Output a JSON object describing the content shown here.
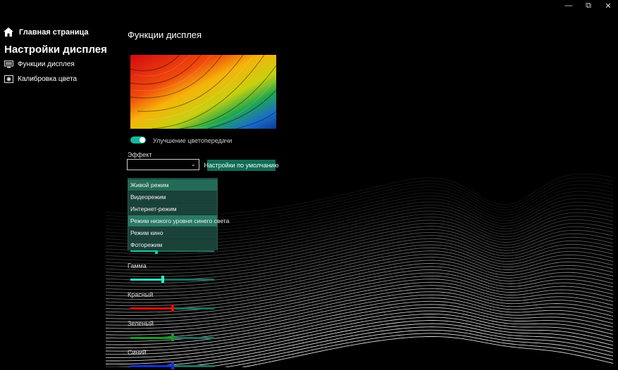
{
  "window": {
    "minimize_glyph": "—",
    "maximize_glyph": "⧉",
    "close_glyph": "✕"
  },
  "sidebar": {
    "home_label": "Главная страница",
    "section_title": "Настройки дисплея",
    "items": [
      {
        "label": "Функции дисплея",
        "icon": "monitor-icon"
      },
      {
        "label": "Калибровка цвета",
        "icon": "calibration-icon"
      }
    ]
  },
  "main": {
    "page_title": "Функции дисплея",
    "color_enhancement": {
      "label": "Улучшение цветопередачи",
      "on": true
    },
    "effect": {
      "label": "Эффект",
      "selected": "",
      "chevron": "⌄",
      "options": [
        "Живой режим",
        "Видеорежим",
        "Интернет-режим",
        "Режим низкого уровня синего света",
        "Режим кино",
        "Фоторежим"
      ],
      "active_index": 0,
      "hover_index": 3
    },
    "default_button": "Настройки по умолчанию",
    "sliders": [
      {
        "label": "",
        "value": 0.31,
        "color": "#18c9a4"
      },
      {
        "label": "Гамма",
        "value": 0.39,
        "color": "#2ef0c8"
      },
      {
        "label": "Красный",
        "value": 0.5,
        "color": "#e01010"
      },
      {
        "label": "Зеленый",
        "value": 0.5,
        "color": "#10a020"
      },
      {
        "label": "Синий",
        "value": 0.5,
        "color": "#1030e0"
      }
    ]
  },
  "colors": {
    "accent": "#17b99c",
    "button_bg": "#136b57",
    "dropdown_bg": "#1a4238"
  }
}
